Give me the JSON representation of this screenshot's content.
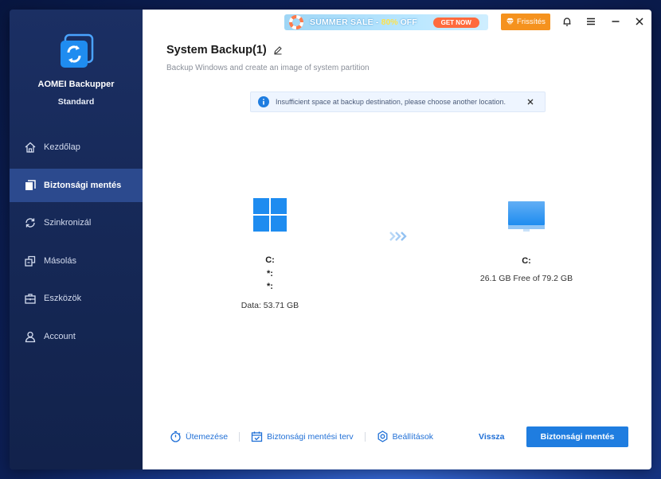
{
  "app": {
    "name": "AOMEI Backupper",
    "edition": "Standard"
  },
  "sidebar": {
    "items": [
      {
        "label": "Kezdőlap",
        "icon": "home-icon"
      },
      {
        "label": "Biztonsági mentés",
        "icon": "backup-icon",
        "active": true
      },
      {
        "label": "Szinkronizál",
        "icon": "sync-icon"
      },
      {
        "label": "Másolás",
        "icon": "clone-icon"
      },
      {
        "label": "Eszközök",
        "icon": "tools-icon"
      },
      {
        "label": "Account",
        "icon": "user-icon"
      }
    ]
  },
  "header": {
    "banner_sale": "SUMMER SALE -",
    "banner_pct": "80%",
    "banner_off": "OFF",
    "banner_cta": "GET NOW",
    "upgrade_label": "Frissítés"
  },
  "page": {
    "title": "System Backup(1)",
    "subtitle": "Backup Windows and create an image of system partition"
  },
  "alert": {
    "message": "Insufficient space at backup destination, please choose another location."
  },
  "source": {
    "lines": [
      "C:",
      "*:",
      "*:"
    ],
    "data": "Data: 53.71 GB"
  },
  "destination": {
    "drive": "C:",
    "free": "26.1 GB Free of 79.2 GB"
  },
  "footer": {
    "schedule_label": "Ütemezése",
    "plan_label": "Biztonsági mentési terv",
    "settings_label": "Beállítások",
    "back_label": "Vissza",
    "start_label": "Biztonsági mentés"
  },
  "colors": {
    "accent": "#1f7de0",
    "sidebar_bg": "#152754",
    "sidebar_active": "#2c4a8e",
    "upgrade": "#f5921e"
  }
}
